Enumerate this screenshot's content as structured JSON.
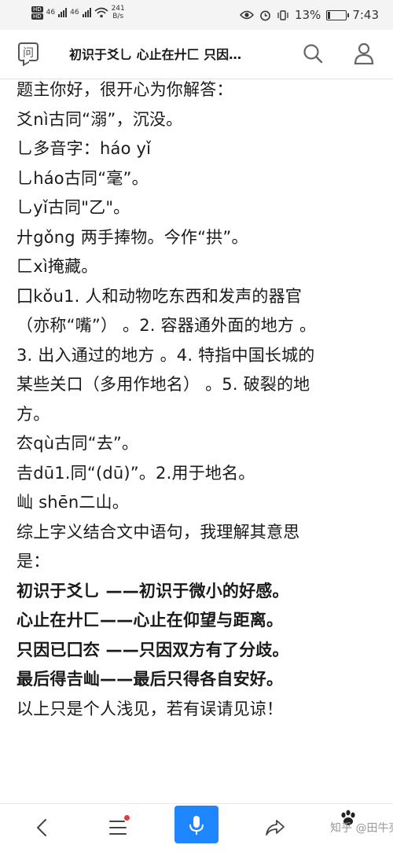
{
  "status_bar": {
    "network_speed": "241",
    "network_unit": "B/s",
    "battery": "13%",
    "time": "7:43"
  },
  "header": {
    "title": "初识于爻乚 心止在廾匚 只因…",
    "ask_icon_glyph": "问"
  },
  "content": {
    "lines": [
      {
        "text": "题主你好，很开心为你解答：",
        "bold": false
      },
      {
        "text": "爻nì古同“溺”，沉没。",
        "bold": false
      },
      {
        "text": "乚多音字：háo yǐ",
        "bold": false
      },
      {
        "text": "乚háo古同“毫”。",
        "bold": false
      },
      {
        "text": "乚yǐ古同\"乙\"。",
        "bold": false
      },
      {
        "text": "廾gǒng 两手捧物。今作“拱”。",
        "bold": false
      },
      {
        "text": "匚xì掩藏。",
        "bold": false
      },
      {
        "text": "囗kǒu1. 人和动物吃东西和发声的器官",
        "bold": false
      },
      {
        "text": "（亦称“嘴”） 。2. 容器通外面的地方 。",
        "bold": false
      },
      {
        "text": "3. 出入通过的地方 。4. 特指中国长城的",
        "bold": false
      },
      {
        "text": "某些关口（多用作地名） 。5. 破裂的地",
        "bold": false
      },
      {
        "text": "方。",
        "bold": false
      },
      {
        "text": "厺qù古同“去”。",
        "bold": false
      },
      {
        "text": "𠮷dū1.同“(dū)”。2.用于地名。",
        "bold": false
      },
      {
        "text": "屾 shēn二山。",
        "bold": false
      },
      {
        "text": "综上字义结合文中语句，我理解其意思",
        "bold": false
      },
      {
        "text": "是：",
        "bold": false
      },
      {
        "text": "初识于爻乚 ——初识于微小的好感。",
        "bold": true
      },
      {
        "text": "心止在廾匚——心止在仰望与距离。",
        "bold": true
      },
      {
        "text": "只因已囗厺 ——只因双方有了分歧。",
        "bold": true
      },
      {
        "text": "最后得𠮷屾——最后只得各自安好。",
        "bold": true
      },
      {
        "text": "以上只是个人浅见，若有误请见谅！",
        "bold": false
      }
    ]
  },
  "bottom_bar": {
    "watermark": "知乎 @田牛亮"
  },
  "colors": {
    "accent": "#1e86ff",
    "badge": "#e63a3a",
    "status_bg": "#f4f4f4"
  }
}
